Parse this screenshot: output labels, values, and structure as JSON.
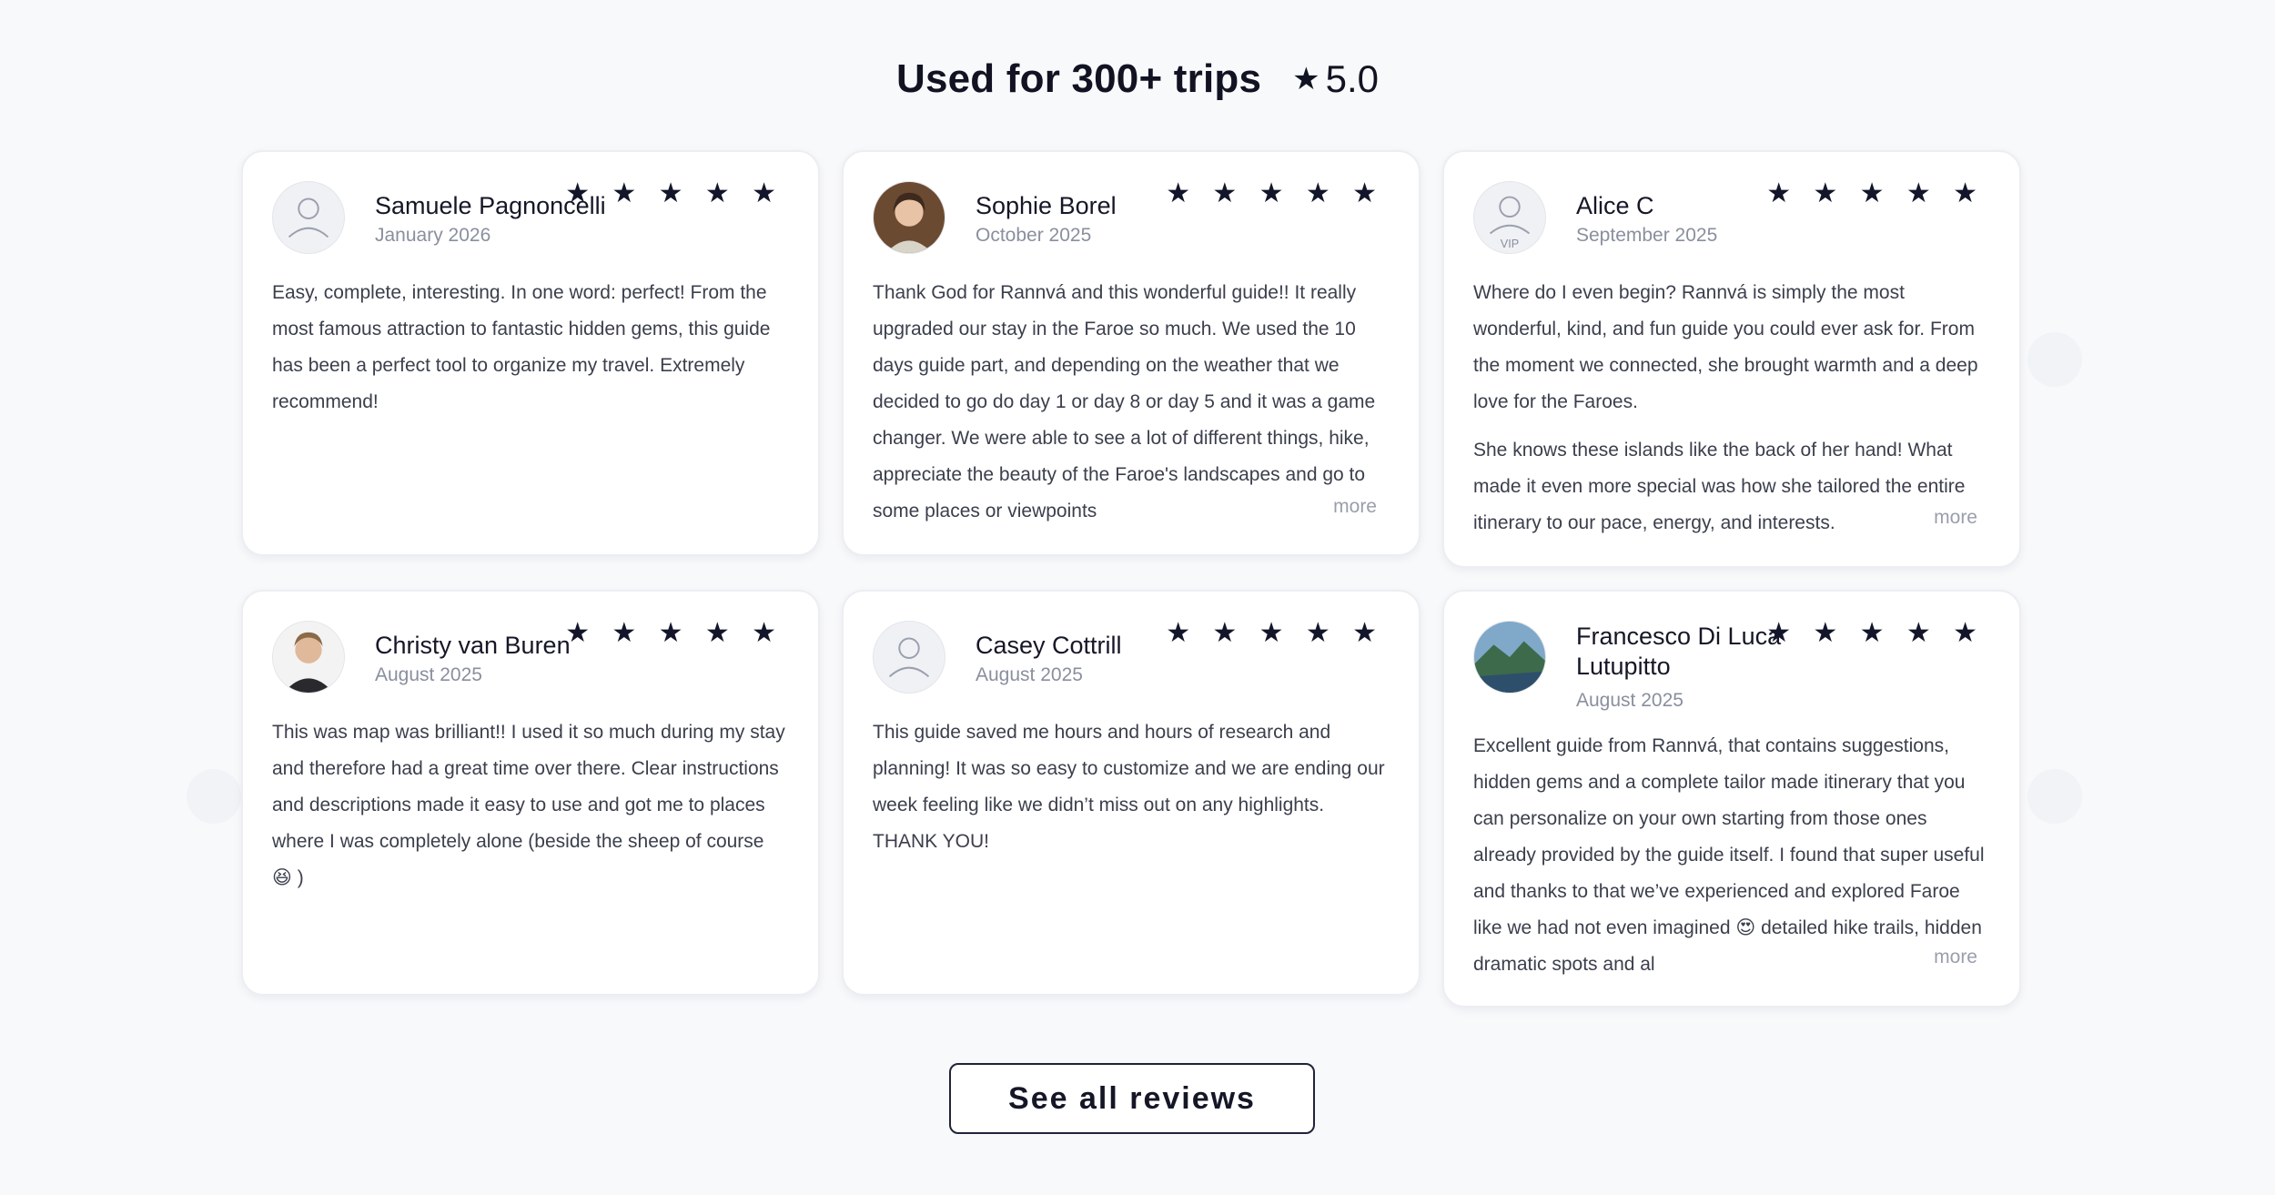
{
  "header": {
    "title": "Used for 300+ trips",
    "rating": "5.0",
    "rating_icon": "star-icon"
  },
  "reviews": [
    {
      "name": "Samuele Pagnoncelli",
      "date": "January 2026",
      "stars": "★ ★ ★ ★ ★",
      "avatar": "default-user-avatar",
      "paragraphs": [
        "Easy, complete, interesting. In one word: perfect! From the most famous attraction to fantastic hidden gems, this guide has been a perfect tool to organize my travel. Extremely recommend!"
      ]
    },
    {
      "name": "Sophie Borel",
      "date": "October 2025",
      "stars": "★ ★ ★ ★ ★",
      "avatar": "user-photo",
      "paragraphs": [
        "Thank God for Rannvá and this wonderful guide!! It really upgraded our stay in the Faroe so much. We used the 10 days guide part, and depending on the weather that we decided to go do day 1 or day 8 or day 5 and it was a game changer. We were able to see a lot of different things, hike, appreciate the beauty of the Faroe's landscapes and go to some places or viewpoints"
      ],
      "more": "more"
    },
    {
      "name": "Alice C",
      "date": "September 2025",
      "stars": "★ ★ ★ ★ ★",
      "avatar": "vip-user-avatar",
      "vip_label": "VIP",
      "paragraphs": [
        "Where do I even begin? Rannvá is simply the most wonderful, kind, and fun guide you could ever ask for. From the moment we connected, she brought warmth and a deep love for the Faroes.",
        "She knows these islands like the back of her hand! What made it even more special was how she tailored the entire itinerary to our pace, energy, and interests."
      ],
      "more": "more"
    },
    {
      "name": "Christy van Buren",
      "date": "August 2025",
      "stars": "★ ★ ★ ★ ★",
      "avatar": "user-photo",
      "paragraphs": [
        "This was map was brilliant!! I used it so much during my stay and therefore had a great time over there. Clear instructions and descriptions made it easy to use and got me to places where I was completely alone (beside the sheep of course 😆 )"
      ]
    },
    {
      "name": "Casey Cottrill",
      "date": "August 2025",
      "stars": "★ ★ ★ ★ ★",
      "avatar": "default-user-avatar",
      "paragraphs": [
        "This guide saved me hours and hours of research and planning! It was so easy to customize and we are ending our week feeling like we didn’t miss out on any highlights. THANK YOU!"
      ]
    },
    {
      "name": "Francesco Di Luca Lutupitto",
      "date": "August 2025",
      "stars": "★ ★ ★ ★ ★",
      "avatar": "landscape-photo",
      "paragraphs": [
        "Excellent guide from Rannvá, that contains suggestions, hidden gems and a complete tailor made itinerary that you can personalize on your own starting from those ones already provided by the guide itself. I found that super useful and thanks to that we’ve experienced and explored Faroe like we had not even imagined 😍 detailed hike trails, hidden dramatic spots and al"
      ],
      "more": "more"
    }
  ],
  "cta": {
    "label": "See all reviews"
  }
}
